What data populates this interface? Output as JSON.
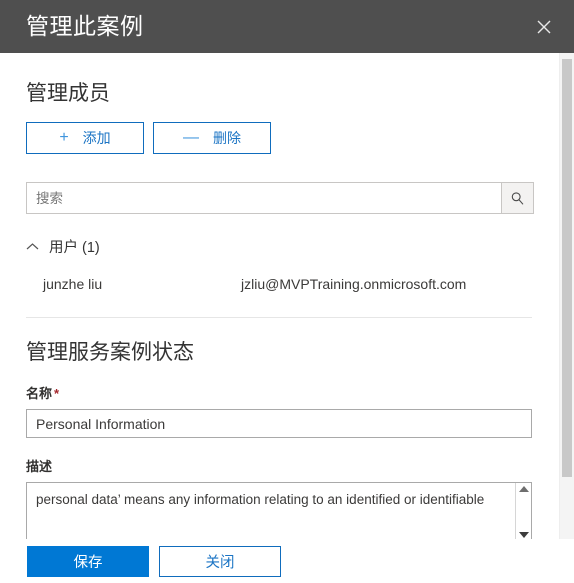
{
  "header": {
    "title": "管理此案例",
    "close_icon": "close-icon"
  },
  "members_section": {
    "heading": "管理成员",
    "commands": [
      {
        "icon": "plus-icon",
        "glyph": "+",
        "label": "添加"
      },
      {
        "icon": "minus-icon",
        "glyph": "—",
        "label": "删除"
      }
    ],
    "search": {
      "placeholder": "搜索",
      "value": "",
      "button_icon": "search-icon"
    },
    "group": {
      "chevron_icon": "chevron-up-icon",
      "label": "用户 (1)"
    },
    "members": [
      {
        "name": "junzhe liu",
        "email": "jzliu@MVPTraining.onmicrosoft.com"
      }
    ]
  },
  "case_section": {
    "heading": "管理服务案例状态",
    "name_field": {
      "label": "名称",
      "required_mark": "*",
      "value": "Personal Information"
    },
    "description_field": {
      "label": "描述",
      "value": "personal data’ means any information relating to an identified or identifiable",
      "scroll_up_icon": "scroll-up-arrow-icon",
      "scroll_down_icon": "scroll-down-arrow-icon"
    }
  },
  "footer": {
    "save_label": "保存",
    "close_label": "关闭"
  },
  "colors": {
    "header_bg": "#4f4f4f",
    "accent": "#0078d4",
    "link": "#1b74c4",
    "required": "#a4262c",
    "border": "#a9a9a9"
  }
}
